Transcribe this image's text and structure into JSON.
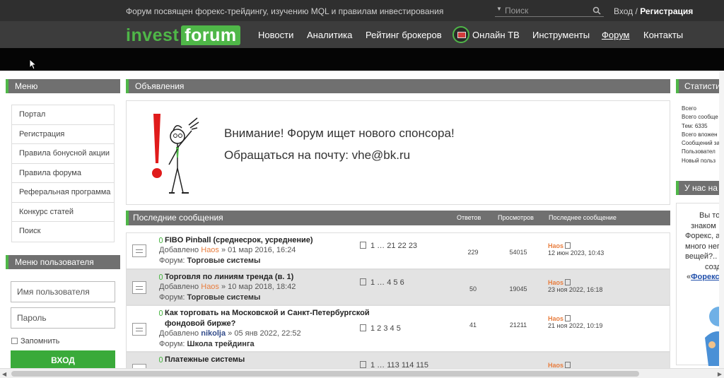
{
  "header": {
    "tagline": "Форум посвящен форекс-трейдингу, изучению MQL и правилам инвестирования",
    "search_placeholder": "Поиск",
    "login": "Вход",
    "separator": "/",
    "register": "Регистрация"
  },
  "logo": {
    "part1": "invest",
    "part2": "forum"
  },
  "nav": [
    "Новости",
    "Аналитика",
    "Рейтинг брокеров",
    "Онлайн ТВ",
    "Инструменты",
    "Форум",
    "Контакты"
  ],
  "left_menu": {
    "title": "Меню",
    "items": [
      "Портал",
      "Регистрация",
      "Правила бонусной акции",
      "Правила форума",
      "Реферальная программа",
      "Конкурс статей",
      "Поиск"
    ]
  },
  "user_menu": {
    "title": "Меню пользователя",
    "username_placeholder": "Имя пользователя",
    "password_placeholder": "Пароль",
    "remember": "Запомнить",
    "login_button": "ВХОД"
  },
  "announcements": {
    "title": "Объявления",
    "line1": "Внимание! Форум ищет нового спонсора!",
    "line2": "Обращаться на почту: vhe@bk.ru"
  },
  "latest": {
    "title": "Последние сообщения",
    "col_replies": "Ответов",
    "col_views": "Просмотров",
    "col_last": "Последнее сообщение"
  },
  "topics": [
    {
      "title": "FIBO Pinball (среднесрок, усреднение)",
      "added": "Добавлено",
      "author": "Haos",
      "date": "» 01 мар 2016, 16:24",
      "forum_label": "Форум:",
      "forum": "Торговые системы",
      "pages": "1 … 21 22 23",
      "replies": "229",
      "views": "54015",
      "last_author": "Haos",
      "last_date": "12 июн 2023, 10:43"
    },
    {
      "title": "Торговля по линиям тренда (в. 1)",
      "added": "Добавлено",
      "author": "Haos",
      "date": "» 10 мар 2018, 18:42",
      "forum_label": "Форум:",
      "forum": "Торговые системы",
      "pages": "1 … 4 5 6",
      "replies": "50",
      "views": "19045",
      "last_author": "Haos",
      "last_date": "23 ноя 2022, 16:18"
    },
    {
      "title": "Как торговать на Московской и Санкт-Петербургской фондовой бирже?",
      "added": "Добавлено",
      "author": "nikolja",
      "date": "» 05 янв 2022, 22:52",
      "forum_label": "Форум:",
      "forum": "Школа трейдинга",
      "pages": "1 2 3 4 5",
      "replies": "41",
      "views": "21211",
      "last_author": "Haos",
      "last_date": "21 ноя 2022, 10:19"
    },
    {
      "title": "Платежные системы",
      "pages": "1 … 113 114 115",
      "last_author": "Haos"
    }
  ],
  "stats": {
    "title": "Статистик",
    "lines": [
      "Всего",
      "Всего сообще",
      "Тем: 6335",
      "Всего вложен",
      "Сообщений за",
      "Пользовател",
      "Новый польз"
    ]
  },
  "right_box": {
    "title": "У нас на ф",
    "lines": [
      "Вы тол",
      "знаком",
      "Форекс, а",
      "много непо",
      "вещей?.. С",
      "созд"
    ],
    "link_prefix": "«",
    "link": "Форекс"
  }
}
